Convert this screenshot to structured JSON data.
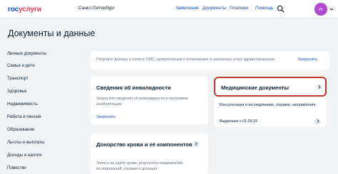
{
  "header": {
    "logo_part1": "гос",
    "logo_part2": "услуги",
    "city": "Санкт-Петербург",
    "nav": [
      "Заявления",
      "Документы",
      "Платежи",
      "Помощь"
    ],
    "avatar_initials": "m",
    "colors": {
      "brand_blue": "#0d4cd3",
      "brand_red": "#ee3f58",
      "avatar": "#b04ad2",
      "highlight_border": "#c0392b"
    }
  },
  "page": {
    "title": "Документы и данные"
  },
  "sidebar": {
    "items": [
      "Личные документы",
      "Семья и дети",
      "Транспорт",
      "Здоровье",
      "Недвижимость",
      "Работа и пенсия",
      "Образование",
      "Льготы и выплаты",
      "Доходы и налоги",
      "Повестки"
    ]
  },
  "oms_banner": {
    "text": "Получите данные о полисе ОМС, прикреплении к поликлинике и оказанных услуг здравоохранения",
    "link": "Запросить"
  },
  "disability_card": {
    "title": "Сведения об инвалидности",
    "description": "Запросите сведения об инвалидности и программе реабилитации",
    "link": "Запросить"
  },
  "medical_card": {
    "title": "Медицинские документы",
    "subtitle": "Консультации и исследования, справки, направления",
    "issued": "Выданные с 01.09.22"
  },
  "blood_card": {
    "title": "Донорство крови и её компонентов",
    "description": "Запись на сдачу крови, результаты медицинских исследований, справки о донации"
  }
}
